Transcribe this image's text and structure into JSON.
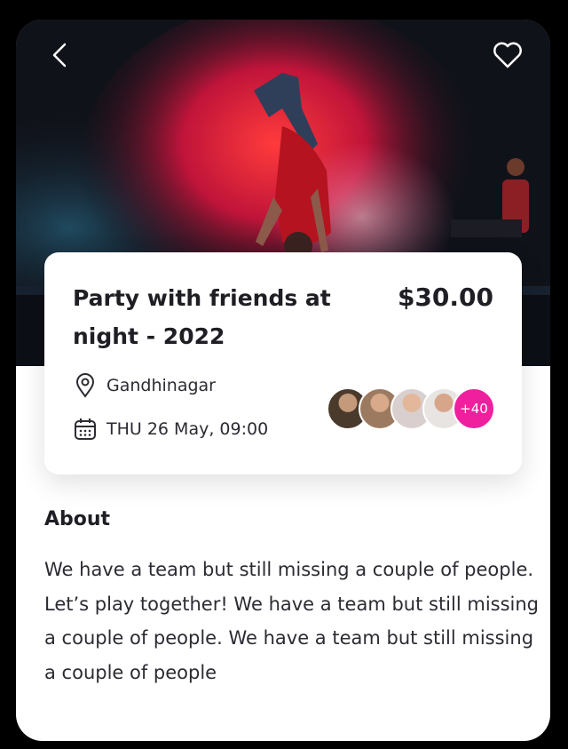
{
  "event": {
    "title": "Party with friends at night - 2022",
    "price": "$30.00",
    "location": "Gandhinagar",
    "datetime": "THU 26 May, 09:00",
    "attendees_more": "+40"
  },
  "about": {
    "heading": "About",
    "text": "We have a team but still missing a couple of people. Let’s play together! We have a team but still missing a couple of people. We have a team but still missing a couple of people"
  },
  "icons": {
    "back": "chevron-left-icon",
    "favorite": "heart-icon",
    "location": "map-pin-icon",
    "date": "calendar-icon"
  },
  "colors": {
    "accent": "#f01f9e",
    "text": "#1e1e24",
    "background": "#ffffff"
  }
}
